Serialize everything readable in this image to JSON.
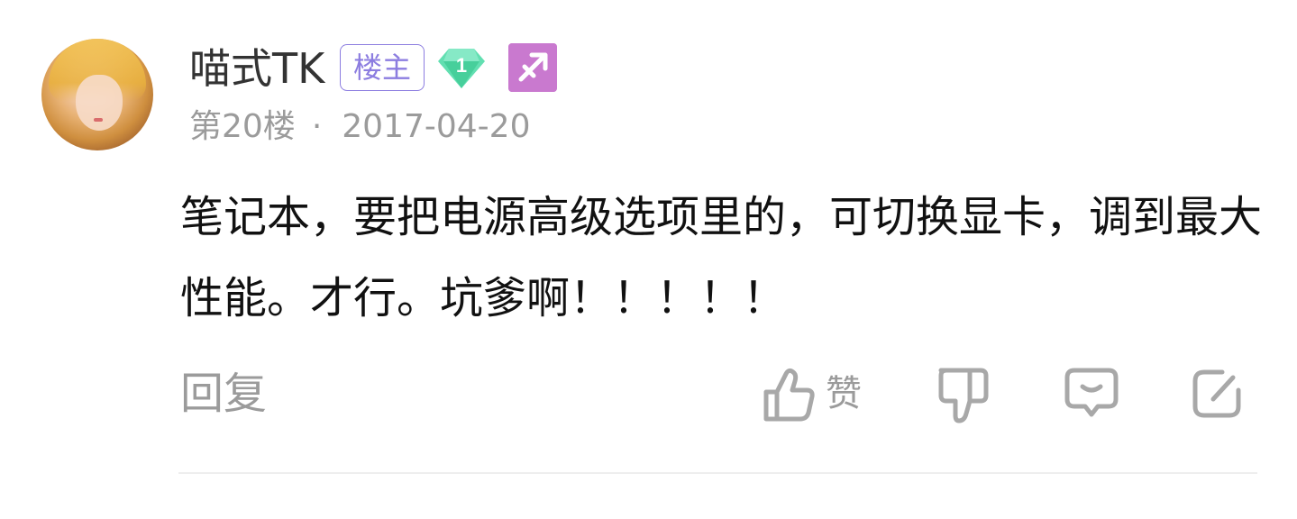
{
  "post": {
    "user_name": "喵式TK",
    "owner_badge": "楼主",
    "level": "1",
    "floor": "第20楼",
    "separator": "·",
    "date": "2017-04-20",
    "content": "笔记本，要把电源高级选项里的，可切换显卡，调到最大性能。才行。坑爹啊！！！！！"
  },
  "actions": {
    "reply_label": "回复",
    "like_label": "赞"
  },
  "colors": {
    "owner_badge": "#8c7de0",
    "level_badge": "#4fd6a4",
    "zodiac_badge": "#c979cf",
    "meta_text": "#9b9b9b",
    "icon_stroke": "#a8a8a8"
  },
  "icons": {
    "level": "green-gem-icon",
    "zodiac": "sagittarius-icon",
    "like": "thumbs-up-icon",
    "dislike": "thumbs-down-icon",
    "comment": "comment-bubble-icon",
    "share": "share-icon"
  }
}
